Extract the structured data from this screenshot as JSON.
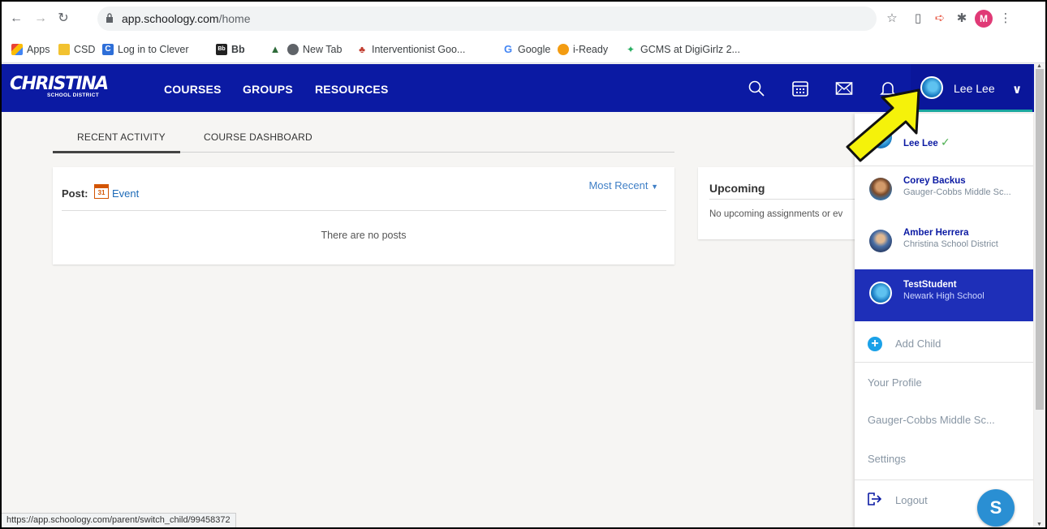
{
  "browser": {
    "url_host": "app.schoology.com",
    "url_path": "/home",
    "profile_initial": "M",
    "bookmarks": [
      {
        "label": "Apps",
        "icon": "apps-grid-icon"
      },
      {
        "label": "CSD",
        "icon": "folder-icon"
      },
      {
        "label": "Log in to Clever",
        "icon": "clever-icon"
      },
      {
        "label": "Bb",
        "icon": "blackboard-icon"
      },
      {
        "label": "",
        "icon": "tree-icon"
      },
      {
        "label": "New Tab",
        "icon": "globe-icon"
      },
      {
        "label": "Interventionist Goo...",
        "icon": "interventionist-icon"
      },
      {
        "label": "Google",
        "icon": "google-icon"
      },
      {
        "label": "i-Ready",
        "icon": "iready-icon"
      },
      {
        "label": "GCMS at DigiGirlz 2...",
        "icon": "digigirlz-icon"
      }
    ]
  },
  "header": {
    "logo_main": "CHRISTINA",
    "logo_sub": "SCHOOL DISTRICT",
    "nav": [
      "COURSES",
      "GROUPS",
      "RESOURCES"
    ],
    "user_name": "Lee Lee",
    "brand_color": "#0b1aa3"
  },
  "tabs": [
    "RECENT ACTIVITY",
    "COURSE DASHBOARD"
  ],
  "feed": {
    "post_label": "Post:",
    "calendar_day": "31",
    "event_label": "Event",
    "sort_label": "Most Recent",
    "empty_text": "There are no posts"
  },
  "upcoming": {
    "title": "Upcoming",
    "empty_text": "No upcoming assignments or ev"
  },
  "dropdown": {
    "people": [
      {
        "name": "Lee Lee",
        "school": "",
        "current": true
      },
      {
        "name": "Corey Backus",
        "school": "Gauger-Cobbs Middle Sc..."
      },
      {
        "name": "Amber Herrera",
        "school": "Christina School District"
      },
      {
        "name": "TestStudent",
        "school": "Newark High School",
        "selected": true
      }
    ],
    "add_child": "Add Child",
    "your_profile": "Your Profile",
    "school_link": "Gauger-Cobbs Middle Sc...",
    "settings": "Settings",
    "logout": "Logout"
  },
  "status_url": "https://app.schoology.com/parent/switch_child/99458372",
  "chat_letter": "S"
}
